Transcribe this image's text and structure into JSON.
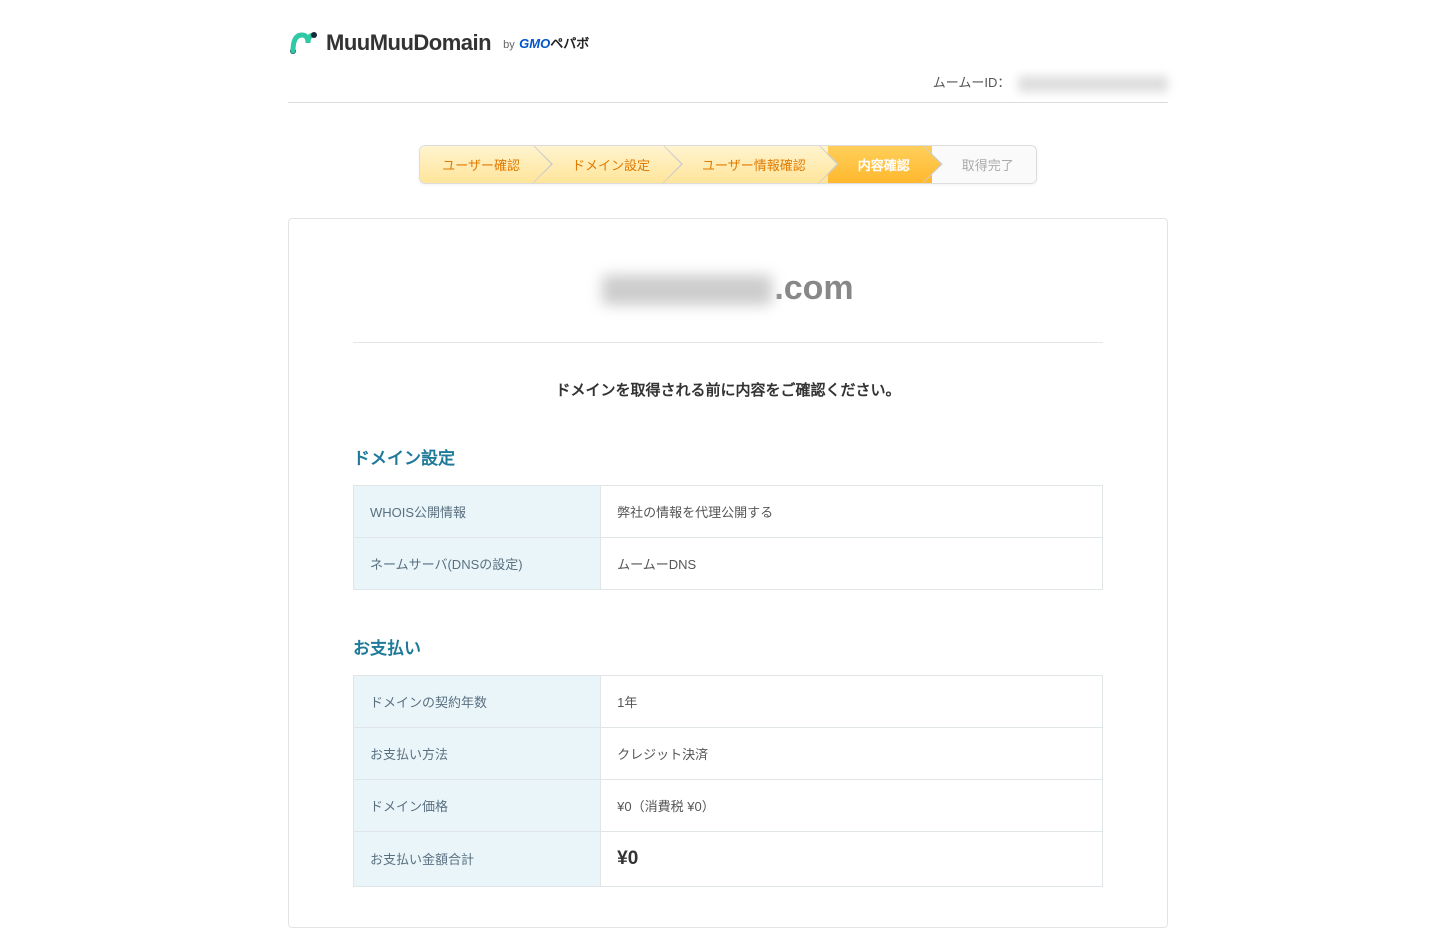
{
  "header": {
    "logo_text": "MuuMuuDomain",
    "logo_by": "by",
    "logo_gmo": "GMO",
    "logo_pepabo": "ペパボ",
    "user_id_label": "ムームーID："
  },
  "steps": [
    {
      "label": "ユーザー確認",
      "state": "done"
    },
    {
      "label": "ドメイン設定",
      "state": "done"
    },
    {
      "label": "ユーザー情報確認",
      "state": "done"
    },
    {
      "label": "内容確認",
      "state": "active"
    },
    {
      "label": "取得完了",
      "state": "inactive"
    }
  ],
  "domain": {
    "tld": ".com"
  },
  "instruction": "ドメインを取得される前に内容をご確認ください。",
  "sections": {
    "domain_settings": {
      "title": "ドメイン設定",
      "rows": [
        {
          "label": "WHOIS公開情報",
          "value": "弊社の情報を代理公開する"
        },
        {
          "label": "ネームサーバ(DNSの設定)",
          "value": "ムームーDNS"
        }
      ]
    },
    "payment": {
      "title": "お支払い",
      "rows": [
        {
          "label": "ドメインの契約年数",
          "value": "1年"
        },
        {
          "label": "お支払い方法",
          "value": "クレジット決済"
        },
        {
          "label": "ドメイン価格",
          "value": "¥0（消費税 ¥0）"
        },
        {
          "label": "お支払い金額合計",
          "value": "¥0",
          "is_total": true
        }
      ]
    }
  }
}
